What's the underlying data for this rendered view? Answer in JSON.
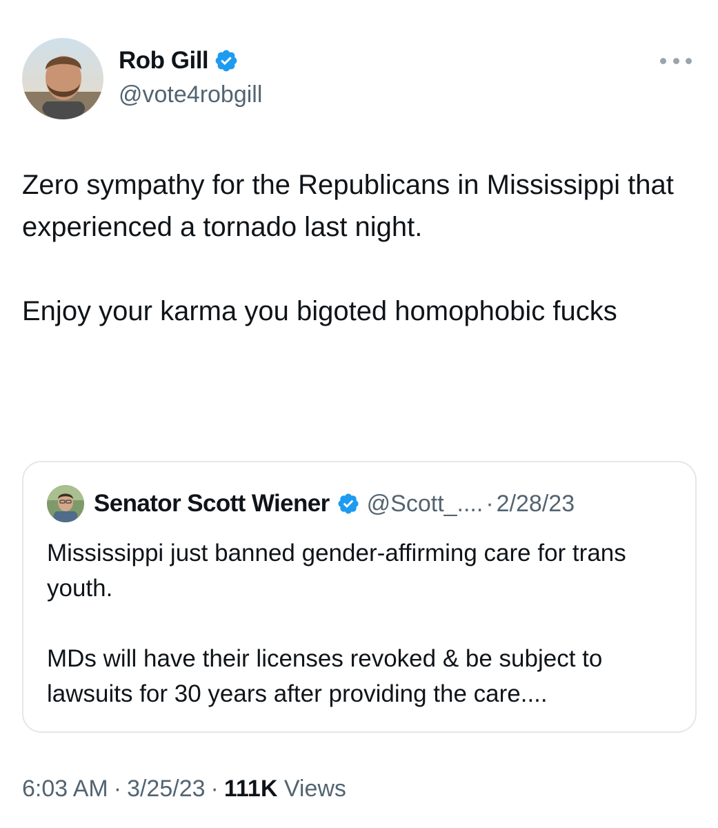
{
  "author": {
    "display_name": "Rob Gill",
    "handle": "@vote4robgill",
    "verified": true
  },
  "tweet": {
    "paragraphs": [
      "Zero sympathy for the Republicans in Mississippi that experienced a tornado last night.",
      "Enjoy your karma you bigoted homophobic fucks"
    ]
  },
  "quoted_tweet": {
    "display_name": "Senator Scott Wiener",
    "handle": "@Scott_....",
    "separator": "·",
    "date": "2/28/23",
    "paragraphs": [
      "Mississippi just banned gender-affirming care for trans youth.",
      "MDs will have their licenses revoked & be subject to lawsuits for 30 years after providing the care...."
    ]
  },
  "meta": {
    "time": "6:03 AM",
    "separator": "·",
    "date": "3/25/23",
    "views_count": "111K",
    "views_label": "Views"
  },
  "colors": {
    "verified_badge": "#1d9bf0",
    "secondary_text": "#536471",
    "primary_text": "#0f1419",
    "border": "#e3e7ea"
  },
  "icons": {
    "verified": "verified-badge-icon",
    "more": "more-dots-icon"
  }
}
